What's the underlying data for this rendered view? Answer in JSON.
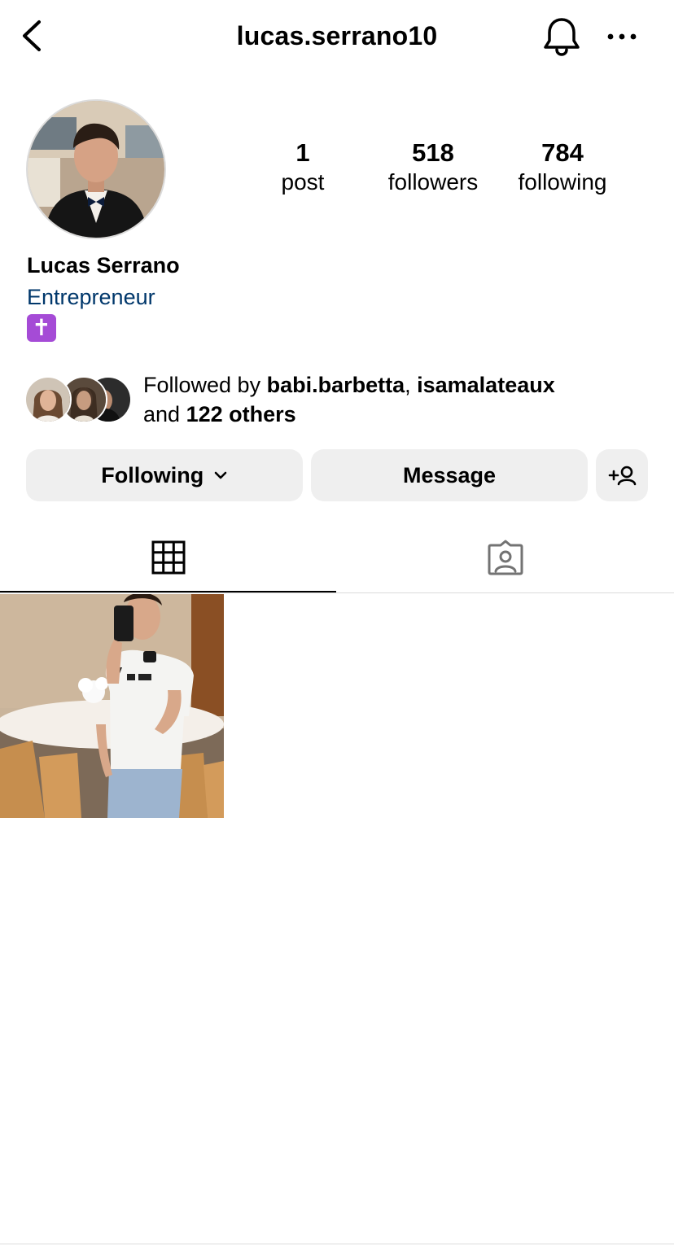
{
  "header": {
    "username": "lucas.serrano10",
    "back_icon": "chevron-left-icon",
    "bell_icon": "bell-icon",
    "more_icon": "ellipsis-icon"
  },
  "stats": {
    "posts": {
      "value": "1",
      "label": "post"
    },
    "followers": {
      "value": "518",
      "label": "followers"
    },
    "following": {
      "value": "784",
      "label": "following"
    }
  },
  "profile": {
    "name": "Lucas Serrano",
    "category": "Entrepreneur",
    "bio_emoji": "✝"
  },
  "mutuals": {
    "prefix": "Followed by ",
    "user1": "babi.barbetta",
    "separator": ", ",
    "user2": "isamalateaux",
    "middle": "and ",
    "others": "122 others"
  },
  "actions": {
    "following_label": "Following",
    "message_label": "Message"
  },
  "tabs": {
    "posts_icon": "grid-icon",
    "tagged_icon": "tagged-person-icon"
  },
  "colors": {
    "category_link": "#00376b",
    "button_bg": "#efefef",
    "divider": "#dbdbdb",
    "emoji_bg": "#a54bd6"
  }
}
